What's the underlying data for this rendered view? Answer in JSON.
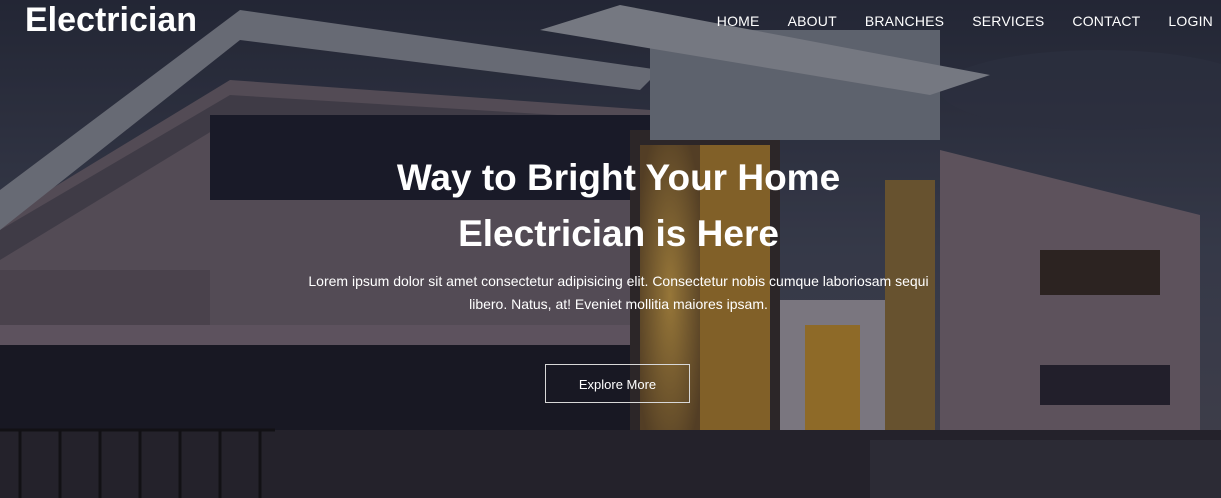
{
  "brand": "Electrician",
  "nav": [
    "HOME",
    "ABOUT",
    "BRANCHES",
    "SERVICES",
    "CONTACT",
    "LOGIN"
  ],
  "hero": {
    "title_line1": "Way to Bright Your Home",
    "title_line2": "Electrician is Here",
    "subtitle": "Lorem ipsum dolor sit amet consectetur adipisicing elit. Consectetur nobis cumque laboriosam sequi libero. Natus, at! Eveniet mollitia maiores ipsam.",
    "cta": "Explore More"
  },
  "colors": {
    "overlay": "#14121c",
    "text": "#ffffff"
  }
}
